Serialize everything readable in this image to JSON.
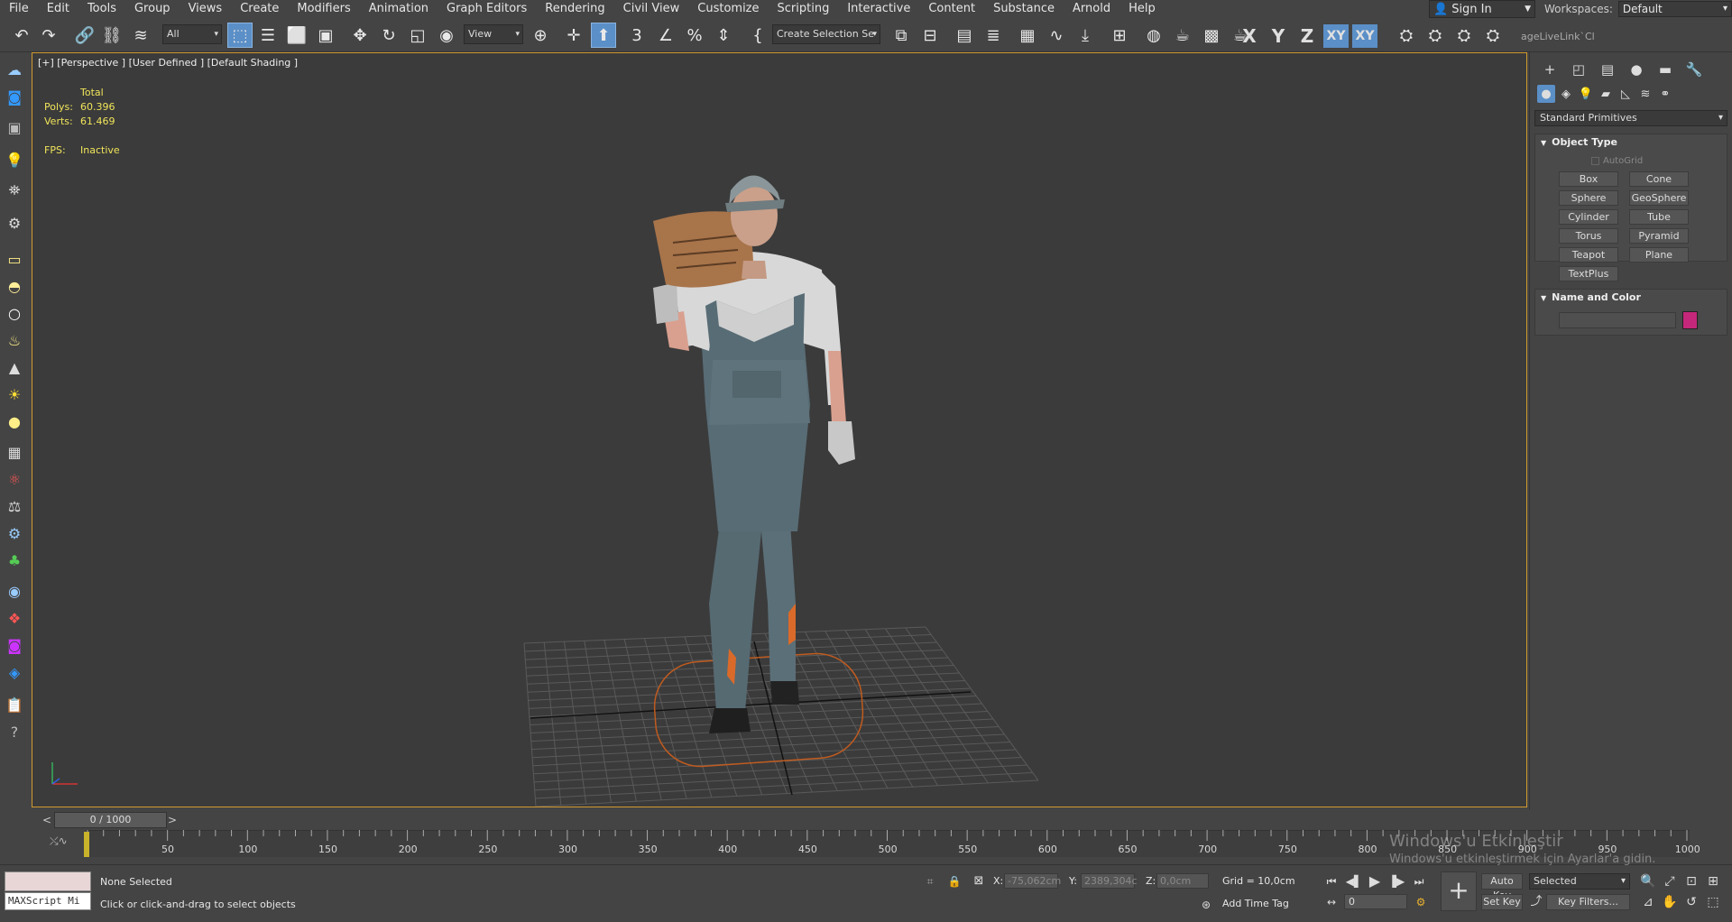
{
  "menu": [
    "File",
    "Edit",
    "Tools",
    "Group",
    "Views",
    "Create",
    "Modifiers",
    "Animation",
    "Graph Editors",
    "Rendering",
    "Civil View",
    "Customize",
    "Scripting",
    "Interactive",
    "Content",
    "Substance",
    "Arnold",
    "Help"
  ],
  "signin": "Sign In",
  "workspaces": {
    "label": "Workspaces:",
    "value": "Default"
  },
  "toolbar": {
    "filter": "All",
    "refcoord": "View",
    "selection_set": "Create Selection Se",
    "axes": [
      "X",
      "Y",
      "Z",
      "XY",
      "XY"
    ],
    "livelink": "ageLiveLink`Cl"
  },
  "viewport": {
    "label": "[+] [Perspective ] [User Defined ] [Default Shading ]",
    "stats": {
      "total_label": "Total",
      "polys_label": "Polys:",
      "polys": "60.396",
      "verts_label": "Verts:",
      "verts": "61.469",
      "fps_label": "FPS:",
      "fps": "Inactive"
    }
  },
  "cmdpanel": {
    "primitive_type": "Standard Primitives",
    "object_type_title": "Object Type",
    "autogrid": "AutoGrid",
    "buttons": [
      "Box",
      "Cone",
      "Sphere",
      "GeoSphere",
      "Cylinder",
      "Tube",
      "Torus",
      "Pyramid",
      "Teapot",
      "Plane",
      "TextPlus"
    ],
    "name_color_title": "Name and Color",
    "object_color": "#c5287a"
  },
  "timeline": {
    "frame_display": "0 / 1000",
    "prev": "<",
    "next": ">",
    "ticks": [
      "50",
      "100",
      "150",
      "200",
      "250",
      "300",
      "350",
      "400",
      "450",
      "500",
      "550",
      "600",
      "650",
      "700",
      "750",
      "800",
      "850",
      "900",
      "950",
      "1000"
    ]
  },
  "status": {
    "maxscript": "MAXScript Mi",
    "selection": "None Selected",
    "prompt": "Click or click-and-drag to select objects",
    "x_label": "X:",
    "x_value": "-75,062cm",
    "y_label": "Y:",
    "y_value": "2389,304c",
    "z_label": "Z:",
    "z_value": "0,0cm",
    "grid": "Grid = 10,0cm",
    "add_time_tag": "Add Time Tag",
    "frame": "0",
    "auto_key": "Auto Key",
    "set_key": "Set Key",
    "key_selection": "Selected",
    "key_filters": "Key Filters..."
  },
  "watermark": {
    "line1": "Windows'u Etkinleştir",
    "line2": "Windows'u etkinleştirmek için Ayarlar'a gidin."
  }
}
